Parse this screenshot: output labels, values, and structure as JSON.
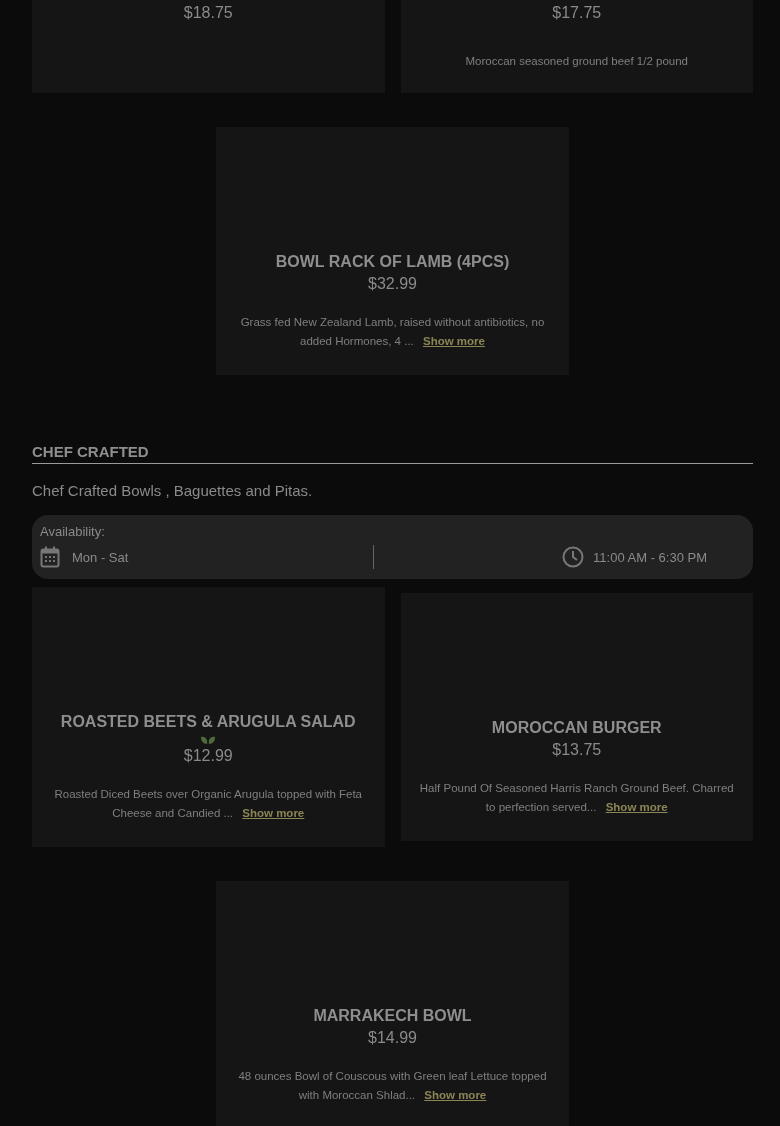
{
  "upper_items": [
    {
      "price": "$18.75"
    },
    {
      "price": "$17.75",
      "description": "Moroccan seasoned ground beef 1/2 pound"
    },
    {
      "name": "BOWL RACK OF LAMB (4PCS)",
      "price": "$32.99",
      "description": "Grass fed New Zealand Lamb, raised without antibiotics, no added Hormones, 4 ...",
      "link": "Show more"
    }
  ],
  "section": {
    "title": "CHEF CRAFTED",
    "description": "Chef Crafted Bowls , Baguettes and Pitas.",
    "availability": {
      "label": "Availability:",
      "days": "Mon - Sat",
      "hours": "11:00 AM - 6:30 PM"
    },
    "items": [
      {
        "name": "ROASTED BEETS & ARUGULA SALAD",
        "vegetarian": true,
        "price": "$12.99",
        "description": "Roasted Diced Beets over Organic Arugula topped with Feta Cheese and Candied ...",
        "link": "Show more"
      },
      {
        "name": "MOROCCAN BURGER",
        "vegetarian": false,
        "price": "$13.75",
        "description": "Half Pound Of Seasoned Harris Ranch Ground Beef. Charred to perfection served...",
        "link": "Show more"
      },
      {
        "name": "MARRAKECH BOWL",
        "vegetarian": false,
        "price": "$14.99",
        "description": "48 ounces Bowl of Couscous with Green leaf Lettuce topped with Moroccan Shlad...",
        "link": "Show more"
      }
    ]
  }
}
